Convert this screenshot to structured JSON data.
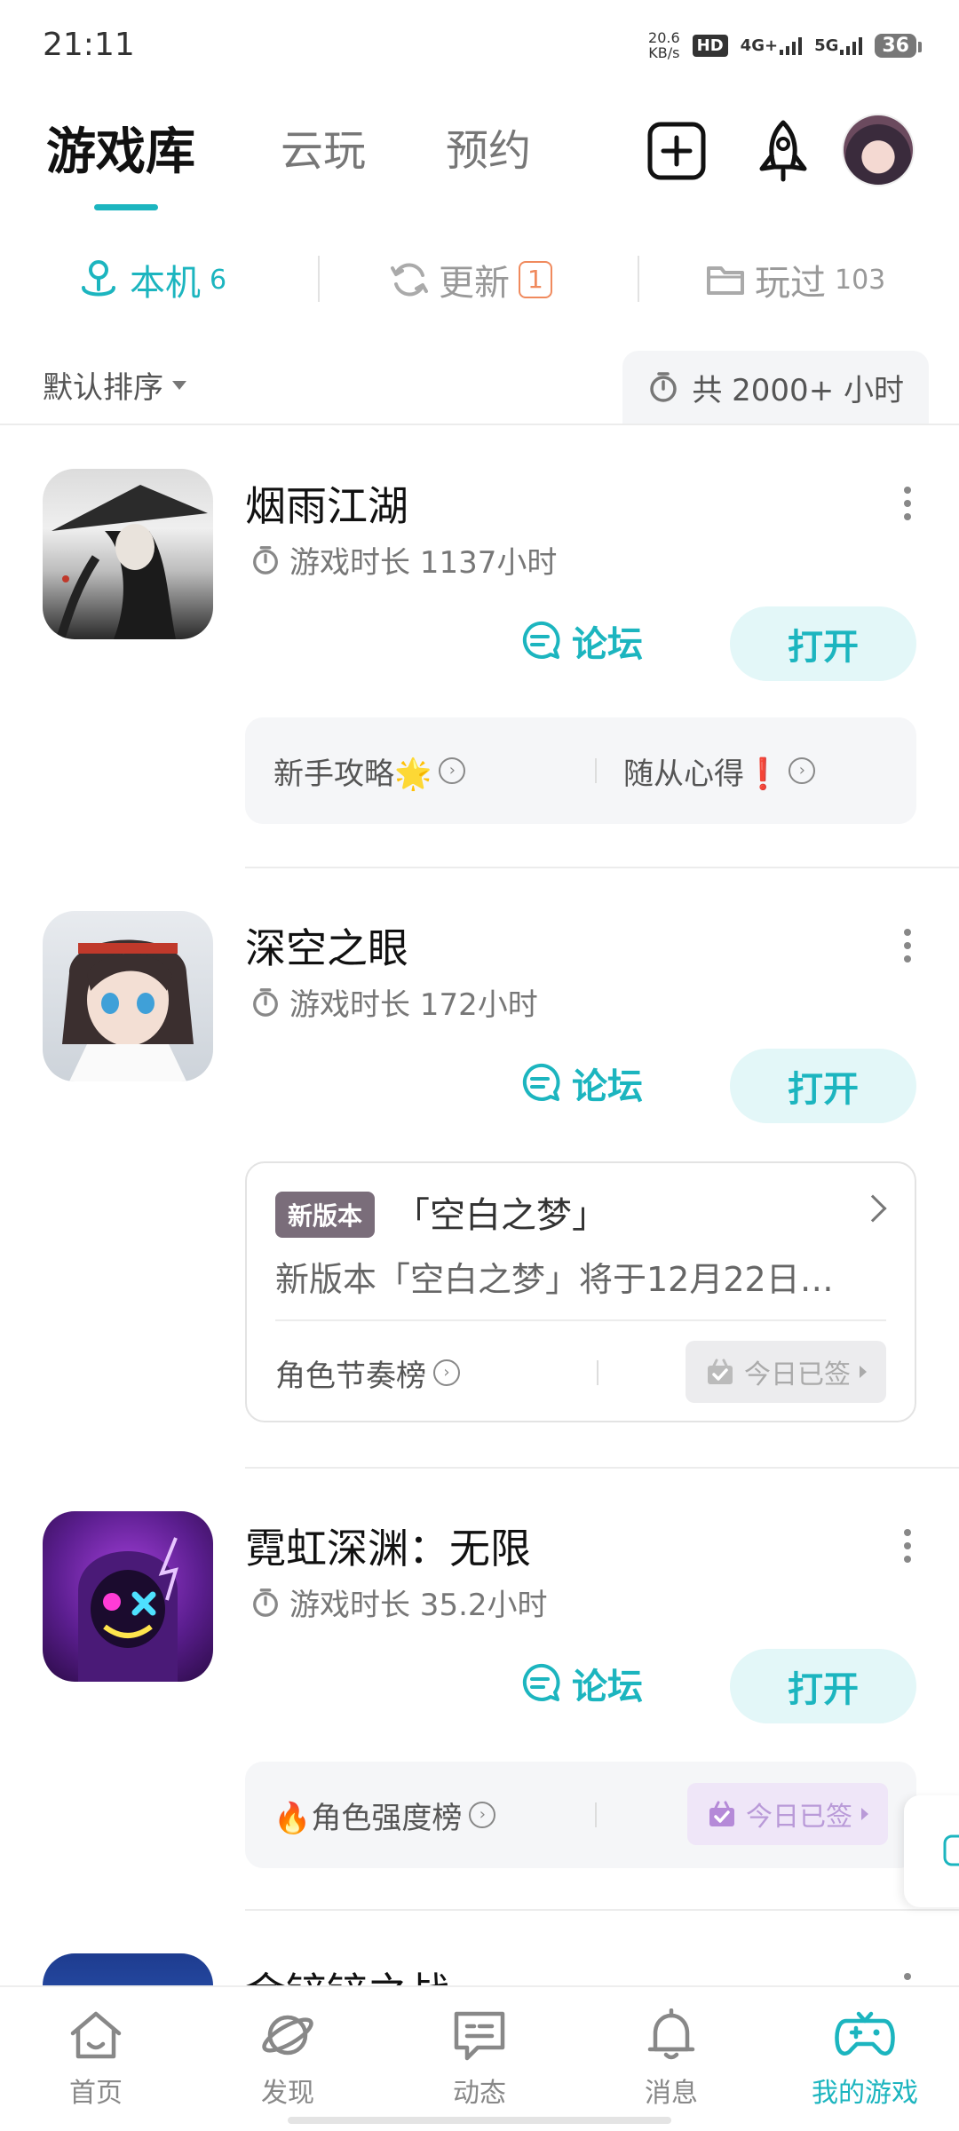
{
  "status_bar": {
    "time": "21:11",
    "speed_value": "20.6",
    "speed_unit": "KB/s",
    "hd_label": "HD",
    "net1": "4G+",
    "net2": "5G",
    "battery": "36"
  },
  "top_tabs": [
    {
      "label": "游戏库",
      "active": true
    },
    {
      "label": "云玩",
      "active": false
    },
    {
      "label": "预约",
      "active": false
    }
  ],
  "sub_tabs": {
    "local": {
      "label": "本机",
      "count": "6"
    },
    "update": {
      "label": "更新",
      "count": "1"
    },
    "played": {
      "label": "玩过",
      "count": "103"
    }
  },
  "sort": {
    "label": "默认排序",
    "total_time": "共 2000+ 小时"
  },
  "games": [
    {
      "name": "烟雨江湖",
      "play_time": "游戏时长 1137小时",
      "forum_label": "论坛",
      "open_label": "打开",
      "panel": {
        "left": "新手攻略🌟",
        "right": "随从心得❗"
      }
    },
    {
      "name": "深空之眼",
      "play_time": "游戏时长 172小时",
      "forum_label": "论坛",
      "open_label": "打开",
      "version": {
        "tag": "新版本",
        "title": "「空白之梦」",
        "desc": "新版本「空白之梦」将于12月22日…",
        "bottom_left": "角色节奏榜",
        "signed": "今日已签"
      }
    },
    {
      "name": "霓虹深渊：无限",
      "play_time": "游戏时长 35.2小时",
      "forum_label": "论坛",
      "open_label": "打开",
      "panel": {
        "left": "🔥角色强度榜",
        "signed": "今日已签"
      }
    },
    {
      "name": "金铲铲之战"
    }
  ],
  "bottom_nav": [
    {
      "label": "首页",
      "icon": "home-icon"
    },
    {
      "label": "发现",
      "icon": "planet-icon"
    },
    {
      "label": "动态",
      "icon": "chat-icon"
    },
    {
      "label": "消息",
      "icon": "bell-icon"
    },
    {
      "label": "我的游戏",
      "icon": "gamepad-icon",
      "active": true
    }
  ],
  "colors": {
    "accent": "#1cb5bf",
    "badge": "#f08a5d"
  }
}
